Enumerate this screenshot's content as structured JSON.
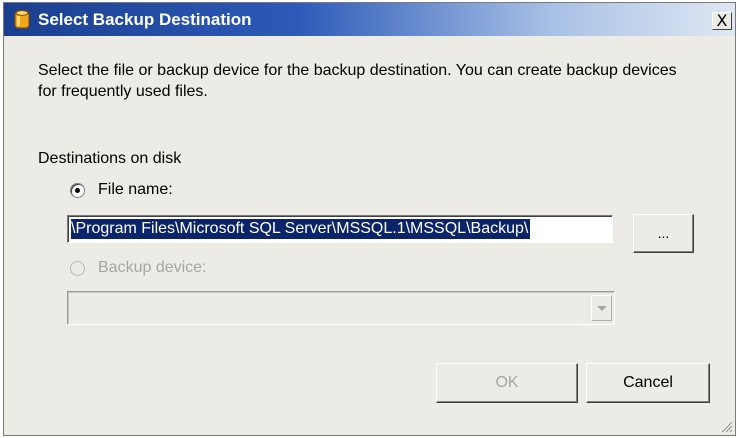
{
  "window": {
    "title": "Select Backup Destination",
    "close_label": "X"
  },
  "instructions": "Select the file or backup device for the backup destination. You can create backup devices for frequently used files.",
  "destinations": {
    "group_label": "Destinations on disk",
    "file_name": {
      "label": "File name:",
      "selected": true,
      "value": "\\Program Files\\Microsoft SQL Server\\MSSQL.1\\MSSQL\\Backup\\"
    },
    "browse_label": "...",
    "backup_device": {
      "label": "Backup device:",
      "selected": false,
      "enabled": false,
      "value": ""
    }
  },
  "buttons": {
    "ok": "OK",
    "cancel": "Cancel",
    "ok_enabled": false
  },
  "colors": {
    "title_start": "#1b3f8f",
    "title_end": "#dfe7f3",
    "selection": "#0a246a",
    "dialog_bg": "#ecebe6",
    "disabled_text": "#a6a6a6"
  },
  "icons": {
    "title": "backup-database-icon",
    "grip": "resize-grip-icon"
  }
}
